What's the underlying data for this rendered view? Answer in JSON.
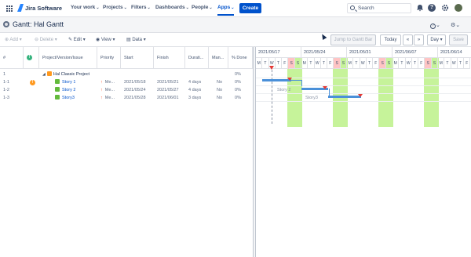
{
  "topnav": {
    "brand": "Jira Software",
    "items": [
      {
        "label": "Your work",
        "chev": "⌄"
      },
      {
        "label": "Projects",
        "chev": "⌄"
      },
      {
        "label": "Filters",
        "chev": "⌄"
      },
      {
        "label": "Dashboards",
        "chev": "⌄"
      },
      {
        "label": "People",
        "chev": "⌄"
      },
      {
        "label": "Apps",
        "chev": "⌄"
      }
    ],
    "create_label": "Create",
    "search_placeholder": "Search"
  },
  "header": {
    "title": "Gantt:  Hal Gantt",
    "help_chev": "⌄",
    "settings_chev": "⌄"
  },
  "toolbar": {
    "add": "Add",
    "delete": "Delete",
    "edit": "Edit",
    "view": "View",
    "data": "Data",
    "jump": "Jump to Gantt Bar",
    "today": "Today",
    "prev": "«",
    "next": "»",
    "scale": "Day",
    "save": "Save"
  },
  "table": {
    "columns": [
      "#",
      "",
      "Project/Version/Issue",
      "Priority",
      "Start",
      "Finish",
      "Durati...",
      "Man...",
      "% Done"
    ],
    "rows": [
      {
        "num": "1",
        "issue": "Hal Classic Project",
        "priority": "",
        "start": "",
        "finish": "",
        "duration": "",
        "manual": "",
        "done": "0%"
      },
      {
        "num": "1-1",
        "issue": "Story 1",
        "priority": "Me...",
        "start": "2021/05/18",
        "finish": "2021/05/21",
        "duration": "4 days",
        "manual": "No",
        "done": "0%"
      },
      {
        "num": "1-2",
        "issue": "Story 2",
        "priority": "Me...",
        "start": "2021/05/24",
        "finish": "2021/05/27",
        "duration": "4 days",
        "manual": "No",
        "done": "0%"
      },
      {
        "num": "1-3",
        "issue": "Story3",
        "priority": "Me...",
        "start": "2021/05/28",
        "finish": "2021/06/01",
        "duration": "3 days",
        "manual": "No",
        "done": "0%"
      }
    ]
  },
  "gantt": {
    "weeks": [
      "2021/05/17",
      "2021/05/24",
      "2021/05/31",
      "2021/06/07",
      "2021/06/14"
    ],
    "days": [
      "M",
      "T",
      "W",
      "T",
      "F",
      "S",
      "S"
    ],
    "bar_labels": [
      "Story 2",
      "Story3"
    ]
  },
  "colors": {
    "accent": "#0052cc",
    "weekend_green": "#c6f39a",
    "weekend_red": "#ffc4c4",
    "bar": "#4a90d9"
  }
}
